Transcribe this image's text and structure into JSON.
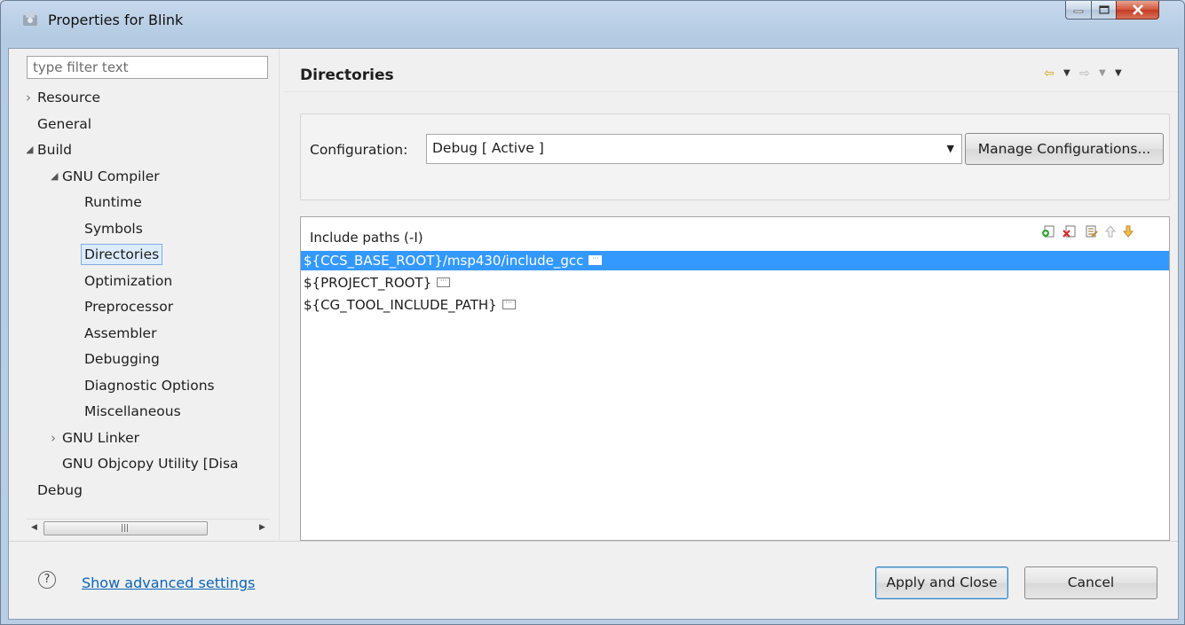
{
  "window": {
    "title": "Properties for Blink"
  },
  "filter": {
    "placeholder": "type filter text"
  },
  "tree": {
    "items": [
      {
        "label": "Resource",
        "level": 0,
        "twisty": "collapsed"
      },
      {
        "label": "General",
        "level": 0,
        "twisty": "none"
      },
      {
        "label": "Build",
        "level": 0,
        "twisty": "expanded"
      },
      {
        "label": "GNU Compiler",
        "level": 1,
        "twisty": "expanded"
      },
      {
        "label": "Runtime",
        "level": 2,
        "twisty": "none"
      },
      {
        "label": "Symbols",
        "level": 2,
        "twisty": "none"
      },
      {
        "label": "Directories",
        "level": 2,
        "twisty": "none",
        "selected": true
      },
      {
        "label": "Optimization",
        "level": 2,
        "twisty": "none"
      },
      {
        "label": "Preprocessor",
        "level": 2,
        "twisty": "none"
      },
      {
        "label": "Assembler",
        "level": 2,
        "twisty": "none"
      },
      {
        "label": "Debugging",
        "level": 2,
        "twisty": "none"
      },
      {
        "label": "Diagnostic Options",
        "level": 2,
        "twisty": "none"
      },
      {
        "label": "Miscellaneous",
        "level": 2,
        "twisty": "none"
      },
      {
        "label": "GNU Linker",
        "level": 1,
        "twisty": "collapsed"
      },
      {
        "label": "GNU Objcopy Utility  [Disa",
        "level": 1,
        "twisty": "none"
      },
      {
        "label": "Debug",
        "level": 0,
        "twisty": "none"
      }
    ]
  },
  "page": {
    "title": "Directories"
  },
  "config": {
    "label": "Configuration:",
    "selected": "Debug  [ Active ]",
    "manage_label": "Manage Configurations..."
  },
  "include_paths": {
    "title": "Include paths (-I)",
    "rows": [
      {
        "text": "${CCS_BASE_ROOT}/msp430/include_gcc",
        "selected": true
      },
      {
        "text": "${PROJECT_ROOT}",
        "selected": false
      },
      {
        "text": "${CG_TOOL_INCLUDE_PATH}",
        "selected": false
      }
    ]
  },
  "footer": {
    "advanced_link": "Show advanced settings",
    "apply_label": "Apply and Close",
    "cancel_label": "Cancel"
  },
  "colors": {
    "selection": "#3399ff",
    "link": "#0b64b9"
  }
}
